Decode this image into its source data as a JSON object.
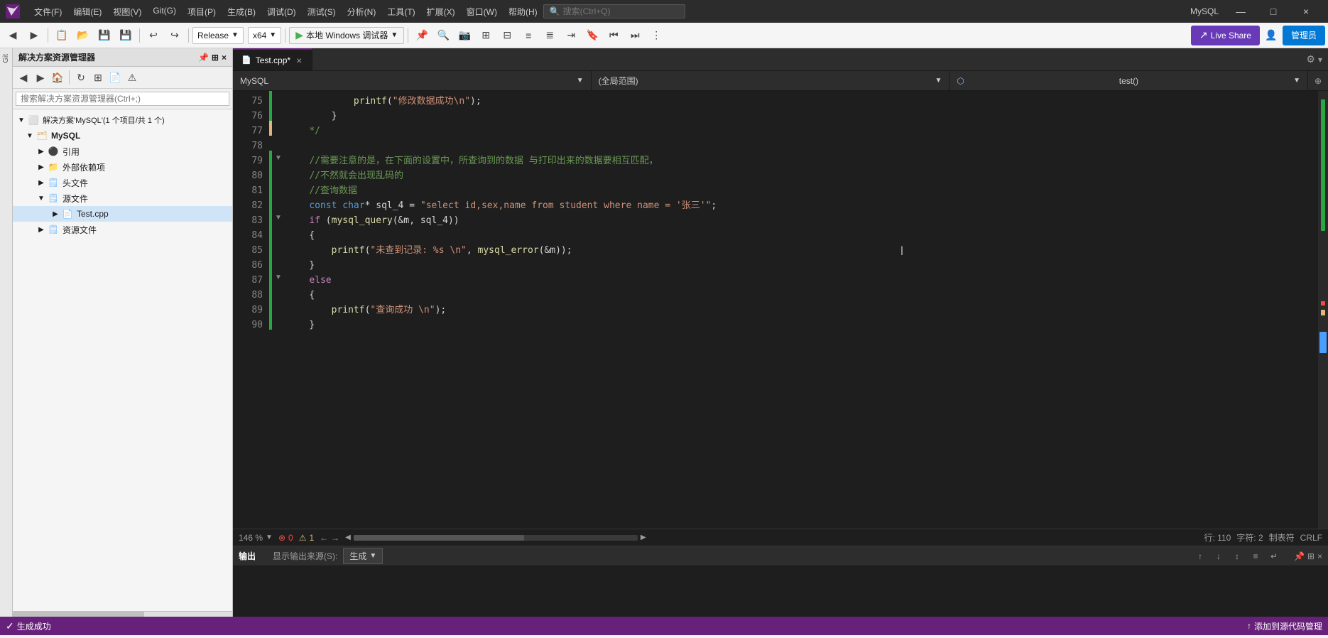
{
  "titleBar": {
    "logo": "VS",
    "menus": [
      "文件(F)",
      "编辑(E)",
      "视图(V)",
      "Git(G)",
      "项目(P)",
      "生成(B)",
      "调试(D)",
      "测试(S)",
      "分析(N)",
      "工具(T)",
      "扩展(X)",
      "窗口(W)",
      "帮助(H)"
    ],
    "searchPlaceholder": "搜索(Ctrl+Q)",
    "profileName": "MySQL",
    "windowControls": [
      "—",
      "□",
      "×"
    ]
  },
  "toolbar": {
    "configuration": "Release",
    "platform": "x64",
    "runTarget": "本地 Windows 调试器",
    "liveShare": "Live Share",
    "adminBtn": "管理员"
  },
  "solutionExplorer": {
    "title": "解决方案资源管理器",
    "searchPlaceholder": "搜索解决方案资源管理器(Ctrl+;)",
    "solution": "解决方案'MySQL'(1 个项目/共 1 个)",
    "project": "MySQL",
    "treeItems": [
      {
        "label": "引用",
        "indent": 2,
        "type": "folder",
        "arrow": "▶"
      },
      {
        "label": "外部依赖项",
        "indent": 2,
        "type": "folder",
        "arrow": "▶"
      },
      {
        "label": "头文件",
        "indent": 2,
        "type": "folder",
        "arrow": "▶"
      },
      {
        "label": "源文件",
        "indent": 2,
        "type": "folder",
        "arrow": "▼"
      },
      {
        "label": "Test.cpp",
        "indent": 3,
        "type": "file",
        "arrow": "▶"
      },
      {
        "label": "资源文件",
        "indent": 2,
        "type": "folder",
        "arrow": "▶"
      }
    ]
  },
  "editor": {
    "tab": "Test.cpp*",
    "nav": {
      "left": "MySQL",
      "middle": "(全局范围)",
      "right": "test()"
    },
    "lines": [
      {
        "num": 75,
        "gutter": "green",
        "fold": "",
        "code": [
          {
            "t": "            "
          },
          {
            "t": "printf(",
            "c": "fn"
          },
          {
            "t": "\"修改数据成功\\n\"",
            "c": "str"
          },
          {
            "t": ");"
          }
        ]
      },
      {
        "num": 76,
        "gutter": "green",
        "fold": "",
        "code": [
          {
            "t": "        "
          },
          {
            "t": "}",
            "c": "plain"
          }
        ]
      },
      {
        "num": 77,
        "gutter": "yellow",
        "fold": "",
        "code": [
          {
            "t": "    "
          },
          {
            "t": "*/",
            "c": "cmt"
          }
        ]
      },
      {
        "num": 78,
        "gutter": "green",
        "fold": "",
        "code": []
      },
      {
        "num": 79,
        "gutter": "green",
        "fold": "▼",
        "code": [
          {
            "t": "    "
          },
          {
            "t": "//需要注意的是，在下面的设置中，所查询到的数据 与打印出来的数据要相互匹配，",
            "c": "cmt"
          }
        ]
      },
      {
        "num": 80,
        "gutter": "green",
        "fold": "",
        "code": [
          {
            "t": "    "
          },
          {
            "t": "//不然就会出现乱码的",
            "c": "cmt"
          }
        ]
      },
      {
        "num": 81,
        "gutter": "green",
        "fold": "",
        "code": [
          {
            "t": "    "
          },
          {
            "t": "//查询数据",
            "c": "cmt"
          }
        ]
      },
      {
        "num": 82,
        "gutter": "green",
        "fold": "",
        "code": [
          {
            "t": "    "
          },
          {
            "t": "const",
            "c": "kw"
          },
          {
            "t": " "
          },
          {
            "t": "char",
            "c": "kw"
          },
          {
            "t": "* sql_4 = "
          },
          {
            "t": "\"select id,sex,name from student where name = '张三'\"",
            "c": "str"
          },
          {
            "t": ";"
          }
        ]
      },
      {
        "num": 83,
        "gutter": "green",
        "fold": "▼",
        "code": [
          {
            "t": "    "
          },
          {
            "t": "if",
            "c": "kw2"
          },
          {
            "t": " ("
          },
          {
            "t": "mysql_query",
            "c": "fn"
          },
          {
            "t": "(&m, sql_4))"
          }
        ]
      },
      {
        "num": 84,
        "gutter": "green",
        "fold": "",
        "code": [
          {
            "t": "    "
          },
          {
            "t": "{",
            "c": "plain"
          }
        ]
      },
      {
        "num": 85,
        "gutter": "green",
        "fold": "",
        "code": [
          {
            "t": "        "
          },
          {
            "t": "printf(",
            "c": "fn"
          },
          {
            "t": "\"未查到记录: %s \\n\"",
            "c": "str"
          },
          {
            "t": ", "
          },
          {
            "t": "mysql_error",
            "c": "fn"
          },
          {
            "t": "(&m));"
          }
        ]
      },
      {
        "num": 86,
        "gutter": "green",
        "fold": "",
        "code": [
          {
            "t": "    "
          },
          {
            "t": "}",
            "c": "plain"
          }
        ]
      },
      {
        "num": 87,
        "gutter": "green",
        "fold": "▼",
        "code": [
          {
            "t": "    "
          },
          {
            "t": "else",
            "c": "kw2"
          }
        ]
      },
      {
        "num": 88,
        "gutter": "green",
        "fold": "",
        "code": [
          {
            "t": "    "
          },
          {
            "t": "{",
            "c": "plain"
          }
        ]
      },
      {
        "num": 89,
        "gutter": "green",
        "fold": "",
        "code": [
          {
            "t": "        "
          },
          {
            "t": "printf(",
            "c": "fn"
          },
          {
            "t": "\"查询成功 \\n\"",
            "c": "str"
          },
          {
            "t": ");"
          }
        ]
      },
      {
        "num": 90,
        "gutter": "green",
        "fold": "",
        "code": [
          {
            "t": "    "
          },
          {
            "t": "}",
            "c": "plain"
          }
        ]
      }
    ],
    "statusBar": {
      "zoom": "146 %",
      "errors": "0",
      "warnings": "1",
      "navLeft": "←",
      "navRight": "→",
      "line": "行: 110",
      "col": "字符: 2",
      "encoding": "制表符",
      "lineEnding": "CRLF"
    }
  },
  "outputPanel": {
    "title": "输出",
    "label": "显示输出来源(S):",
    "source": "生成"
  },
  "statusBar": {
    "buildStatus": "生成成功",
    "rightMsg": "添加到源代码管理"
  }
}
